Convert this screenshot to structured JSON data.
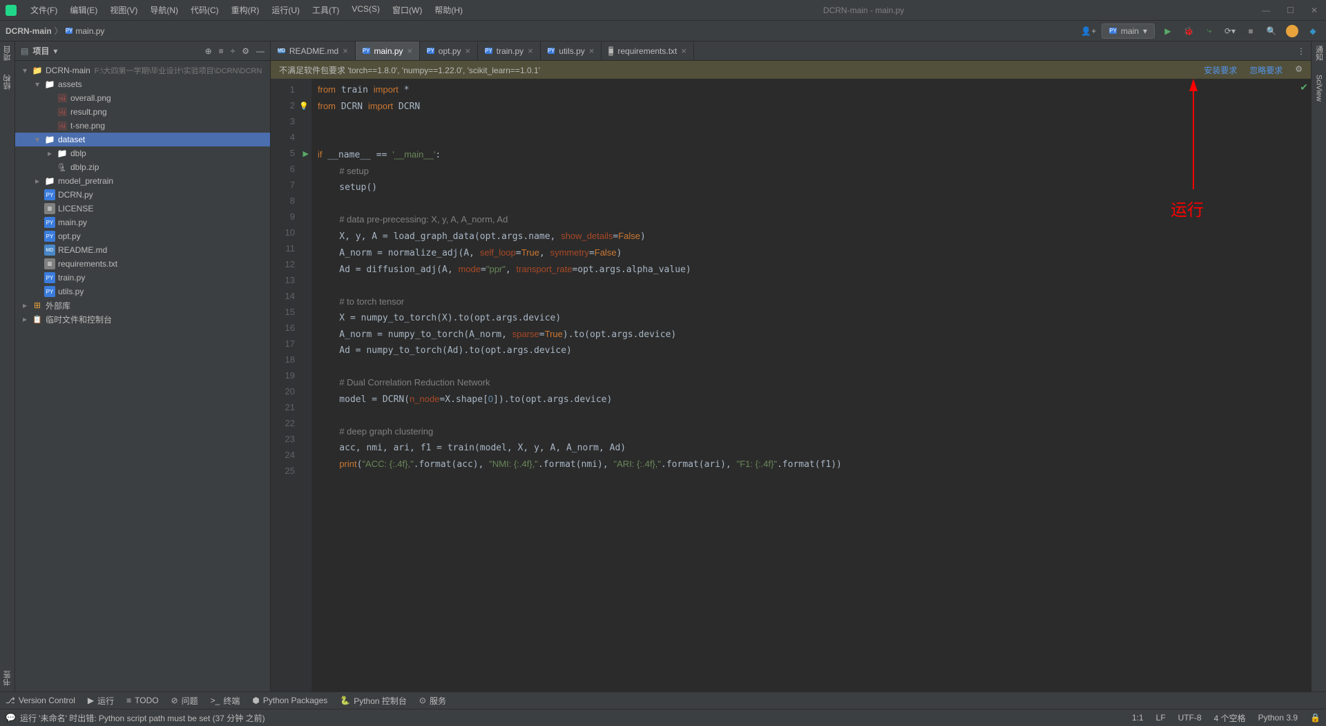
{
  "window": {
    "title": "DCRN-main - main.py"
  },
  "menu": [
    "文件(F)",
    "编辑(E)",
    "视图(V)",
    "导航(N)",
    "代码(C)",
    "重构(R)",
    "运行(U)",
    "工具(T)",
    "VCS(S)",
    "窗口(W)",
    "帮助(H)"
  ],
  "breadcrumb": {
    "root": "DCRN-main",
    "file": "main.py"
  },
  "run_config": {
    "label": "main"
  },
  "sidebar": {
    "title": "项目",
    "root": {
      "name": "DCRN-main",
      "hint": "F:\\大四第一学期\\毕业设计\\实验项目\\DCRN\\DCRN"
    },
    "items": [
      {
        "type": "folder",
        "name": "assets",
        "depth": 1,
        "expanded": true
      },
      {
        "type": "img",
        "name": "overall.png",
        "depth": 2
      },
      {
        "type": "img",
        "name": "result.png",
        "depth": 2
      },
      {
        "type": "img",
        "name": "t-sne.png",
        "depth": 2
      },
      {
        "type": "folder",
        "name": "dataset",
        "depth": 1,
        "expanded": true,
        "selected": true
      },
      {
        "type": "folder",
        "name": "dblp",
        "depth": 2,
        "expanded": false
      },
      {
        "type": "zip",
        "name": "dblp.zip",
        "depth": 2
      },
      {
        "type": "folder",
        "name": "model_pretrain",
        "depth": 1,
        "expanded": false
      },
      {
        "type": "py",
        "name": "DCRN.py",
        "depth": 1
      },
      {
        "type": "txt",
        "name": "LICENSE",
        "depth": 1
      },
      {
        "type": "py",
        "name": "main.py",
        "depth": 1
      },
      {
        "type": "py",
        "name": "opt.py",
        "depth": 1
      },
      {
        "type": "md",
        "name": "README.md",
        "depth": 1
      },
      {
        "type": "txt",
        "name": "requirements.txt",
        "depth": 1
      },
      {
        "type": "py",
        "name": "train.py",
        "depth": 1
      },
      {
        "type": "py",
        "name": "utils.py",
        "depth": 1
      }
    ],
    "extra": [
      {
        "icon": "lib",
        "name": "外部库"
      },
      {
        "icon": "scratch",
        "name": "临时文件和控制台"
      }
    ]
  },
  "left_gutter": [
    "项目",
    "结构"
  ],
  "right_gutter": [
    "通知",
    "SciView"
  ],
  "left_gutter_bottom": "书签",
  "tabs": [
    {
      "icon": "md",
      "label": "README.md",
      "active": false
    },
    {
      "icon": "py",
      "label": "main.py",
      "active": true
    },
    {
      "icon": "py",
      "label": "opt.py",
      "active": false
    },
    {
      "icon": "py",
      "label": "train.py",
      "active": false
    },
    {
      "icon": "py",
      "label": "utils.py",
      "active": false
    },
    {
      "icon": "txt",
      "label": "requirements.txt",
      "active": false
    }
  ],
  "notice": {
    "text": "不满足软件包要求 'torch==1.8.0', 'numpy==1.22.0', 'scikit_learn==1.0.1'",
    "install": "安装要求",
    "ignore": "忽略要求"
  },
  "code_lines": [
    {
      "n": 1,
      "html": "<span class='kw'>from</span> train <span class='kw'>import</span> *"
    },
    {
      "n": 2,
      "html": "<span class='kw'>from</span> DCRN <span class='kw'>import</span> DCRN",
      "bulb": true
    },
    {
      "n": 3,
      "html": ""
    },
    {
      "n": 4,
      "html": ""
    },
    {
      "n": 5,
      "html": "<span class='kw'>if</span> __name__ == <span class='str'>'__main__'</span>:",
      "run": true
    },
    {
      "n": 6,
      "html": "    <span class='com'># setup</span>"
    },
    {
      "n": 7,
      "html": "    setup()"
    },
    {
      "n": 8,
      "html": ""
    },
    {
      "n": 9,
      "html": "    <span class='com'># data pre-precessing: X, y, A, A_norm, Ad</span>"
    },
    {
      "n": 10,
      "html": "    X, y, A = load_graph_data(opt.args.name, <span class='kwarg'>show_details</span>=<span class='kw'>False</span>)"
    },
    {
      "n": 11,
      "html": "    A_norm = normalize_adj(A, <span class='kwarg'>self_loop</span>=<span class='kw'>True</span>, <span class='kwarg'>symmetry</span>=<span class='kw'>False</span>)"
    },
    {
      "n": 12,
      "html": "    Ad = diffusion_adj(A, <span class='kwarg'>mode</span>=<span class='str'>\"ppr\"</span>, <span class='kwarg'>transport_rate</span>=opt.args.alpha_value)"
    },
    {
      "n": 13,
      "html": ""
    },
    {
      "n": 14,
      "html": "    <span class='com'># to torch tensor</span>"
    },
    {
      "n": 15,
      "html": "    X = numpy_to_torch(X).to(opt.args.device)"
    },
    {
      "n": 16,
      "html": "    A_norm = numpy_to_torch(A_norm, <span class='kwarg'>sparse</span>=<span class='kw'>True</span>).to(opt.args.device)"
    },
    {
      "n": 17,
      "html": "    Ad = numpy_to_torch(Ad).to(opt.args.device)"
    },
    {
      "n": 18,
      "html": ""
    },
    {
      "n": 19,
      "html": "    <span class='com'># Dual Correlation Reduction Network</span>"
    },
    {
      "n": 20,
      "html": "    model = DCRN(<span class='kwarg'>n_node</span>=X.shape[<span class='num'>0</span>]).to(opt.args.device)"
    },
    {
      "n": 21,
      "html": ""
    },
    {
      "n": 22,
      "html": "    <span class='com'># deep graph clustering</span>"
    },
    {
      "n": 23,
      "html": "    acc, nmi, ari, f1 = train(model, X, y, A, A_norm, Ad)"
    },
    {
      "n": 24,
      "html": "    <span class='kw'>print</span>(<span class='str'>\"ACC: {:.4f},\"</span>.format(acc), <span class='str'>\"NMI: {:.4f},\"</span>.format(nmi), <span class='str'>\"ARI: {:.4f},\"</span>.format(ari), <span class='str'>\"F1: {:.4f}\"</span>.format(f1))"
    },
    {
      "n": 25,
      "html": ""
    }
  ],
  "annotation": {
    "text": "运行"
  },
  "bottom_tools": [
    {
      "icon": "⎇",
      "label": "Version Control"
    },
    {
      "icon": "▶",
      "label": "运行"
    },
    {
      "icon": "≡",
      "label": "TODO"
    },
    {
      "icon": "⊘",
      "label": "问题"
    },
    {
      "icon": ">_",
      "label": "终端"
    },
    {
      "icon": "⬢",
      "label": "Python Packages"
    },
    {
      "icon": "🐍",
      "label": "Python 控制台"
    },
    {
      "icon": "⊙",
      "label": "服务"
    }
  ],
  "status": {
    "message": "运行 '未命名' 时出错: Python script path must be set (37 分钟 之前)",
    "pos": "1:1",
    "eol": "LF",
    "encoding": "UTF-8",
    "indent": "4 个空格",
    "interpreter": "Python 3.9"
  }
}
